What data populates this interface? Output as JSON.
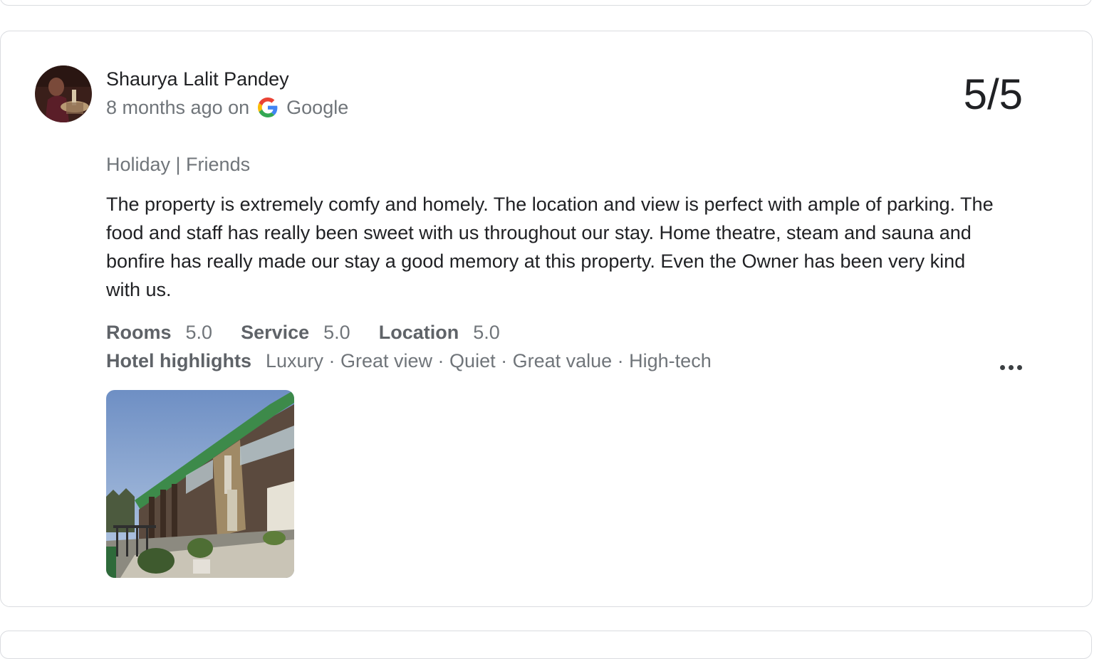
{
  "review": {
    "author": "Shaurya Lalit Pandey",
    "time_ago": "8 months ago on",
    "source": "Google",
    "score": "5/5",
    "trip_type": "Holiday | Friends",
    "text": "The property is extremely comfy and homely. The location and view is perfect with ample of parking. The food and staff has really been sweet with us throughout our stay. Home theatre, steam and sauna and bonfire has really made our stay a good memory at this property. Even the Owner has been very kind with us.",
    "ratings": [
      {
        "label": "Rooms",
        "value": "5.0"
      },
      {
        "label": "Service",
        "value": "5.0"
      },
      {
        "label": "Location",
        "value": "5.0"
      }
    ],
    "highlights_label": "Hotel highlights",
    "highlights": "Luxury · Great view · Quiet · Great value · High-tech"
  },
  "icons": {
    "source_logo": "google-g-icon",
    "menu": "more-options-icon"
  },
  "colors": {
    "border": "#dadce0",
    "text_primary": "#202124",
    "text_secondary": "#70757a"
  }
}
